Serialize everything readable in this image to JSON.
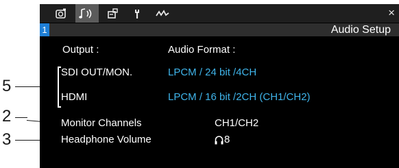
{
  "window": {
    "page_number": "1",
    "title": "Audio Setup",
    "close_glyph": "×"
  },
  "tabs": [
    {
      "icon": "camera-icon",
      "active": false
    },
    {
      "icon": "audio-icon",
      "active": true
    },
    {
      "icon": "video-setup-icon",
      "active": false
    },
    {
      "icon": "wrench-icon",
      "active": false
    },
    {
      "icon": "waveform-icon",
      "active": false
    }
  ],
  "headers": {
    "output": "Output :",
    "format": "Audio Format :"
  },
  "rows": [
    {
      "label": "SDI OUT/MON.",
      "value": "LPCM / 24 bit /4CH"
    },
    {
      "label": "HDMI",
      "value": "LPCM / 16 bit /2CH (CH1/CH2)"
    }
  ],
  "monitor_channels": {
    "label": "Monitor Channels",
    "value": "CH1/CH2"
  },
  "headphone_volume": {
    "label": "Headphone Volume",
    "value": "8",
    "icon": "headphone-icon"
  },
  "callouts": [
    "5",
    "2",
    "3"
  ],
  "colors": {
    "accent_value": "#3fb4ea",
    "page_badge": "#1f7fd6",
    "active_tab": "#5b5b5b"
  }
}
